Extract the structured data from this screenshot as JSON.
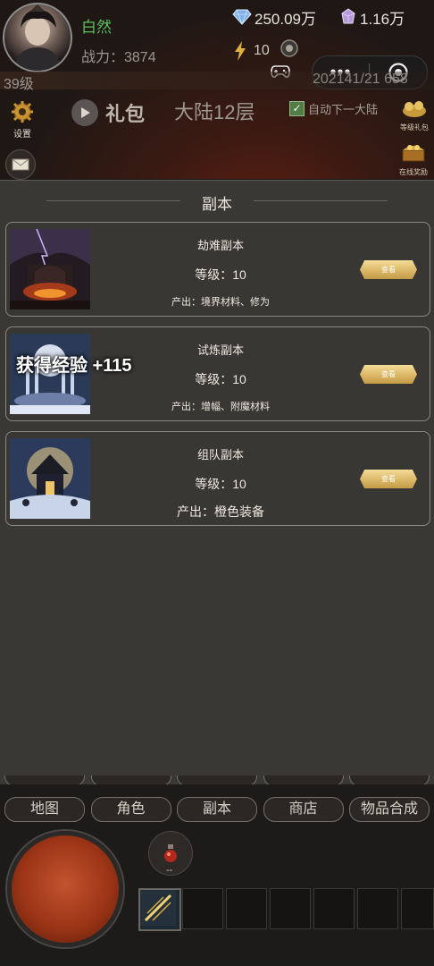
{
  "player": {
    "name": "白然",
    "power": "战力：3874",
    "level": "39级",
    "code": "202141/21 658"
  },
  "currencies": {
    "diamonds": "250.09万",
    "crystals": "1.16万"
  },
  "energy": {
    "value": "10"
  },
  "mini_program": {
    "more": "•••"
  },
  "top_actions": {
    "settings": "设置",
    "gift": "礼包",
    "floor": "大陆12层",
    "auto_next": "自动下一大陆",
    "auto_next_checked": true,
    "rank_gift": "等级礼包",
    "online_reward": "在线奖励"
  },
  "panel": {
    "title": "副本",
    "exp_popup": "获得经验 +115",
    "dungeons": [
      {
        "name": "劫难副本",
        "level": "等级：10",
        "output": "产出：境界材料、修为",
        "button": "查看",
        "theme": "fire"
      },
      {
        "name": "试炼副本",
        "level": "等级：10",
        "output": "产出：增幅、附魔材料",
        "button": "查看",
        "theme": "ice"
      },
      {
        "name": "组队副本",
        "level": "等级：10",
        "output": "产出：橙色装备",
        "button": "查看",
        "theme": "temple"
      }
    ]
  },
  "nav": {
    "top_row": [
      "",
      "",
      "",
      "",
      ""
    ],
    "main_row": [
      "地图",
      "角色",
      "副本",
      "商店",
      "物品合成"
    ]
  },
  "potion": {
    "count": "-- "
  },
  "colors": {
    "accent_gold": "#d9b463",
    "name_green": "#5cc15a"
  }
}
